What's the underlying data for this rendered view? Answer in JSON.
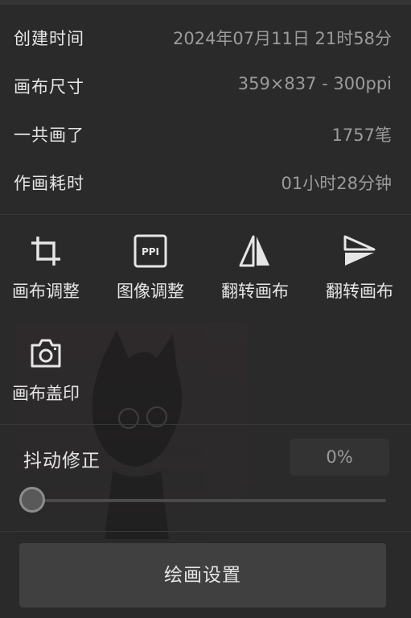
{
  "info": {
    "created_label": "创建时间",
    "created_value": "2024年07月11日 21时58分",
    "canvas_size_label": "画布尺寸",
    "canvas_size_value": "359×837 - 300ppi",
    "strokes_label": "一共画了",
    "strokes_value": "1757笔",
    "time_label": "作画耗时",
    "time_value": "01小时28分钟"
  },
  "tools": [
    {
      "label": "画布调整",
      "icon": "crop-icon"
    },
    {
      "label": "图像调整",
      "icon": "ppi-icon"
    },
    {
      "label": "翻转画布",
      "icon": "flip-horizontal-icon"
    },
    {
      "label": "翻转画布",
      "icon": "flip-vertical-icon"
    },
    {
      "label": "画布盖印",
      "icon": "camera-icon"
    }
  ],
  "stabilizer": {
    "label": "抖动修正",
    "value": "0%",
    "level": 0
  },
  "draw_settings_label": "绘画设置",
  "colors": {
    "panel_bg": "#2a2a2a",
    "text_primary": "#e6e6e6",
    "text_secondary": "#9b9b9b",
    "button_bg": "#404040"
  }
}
